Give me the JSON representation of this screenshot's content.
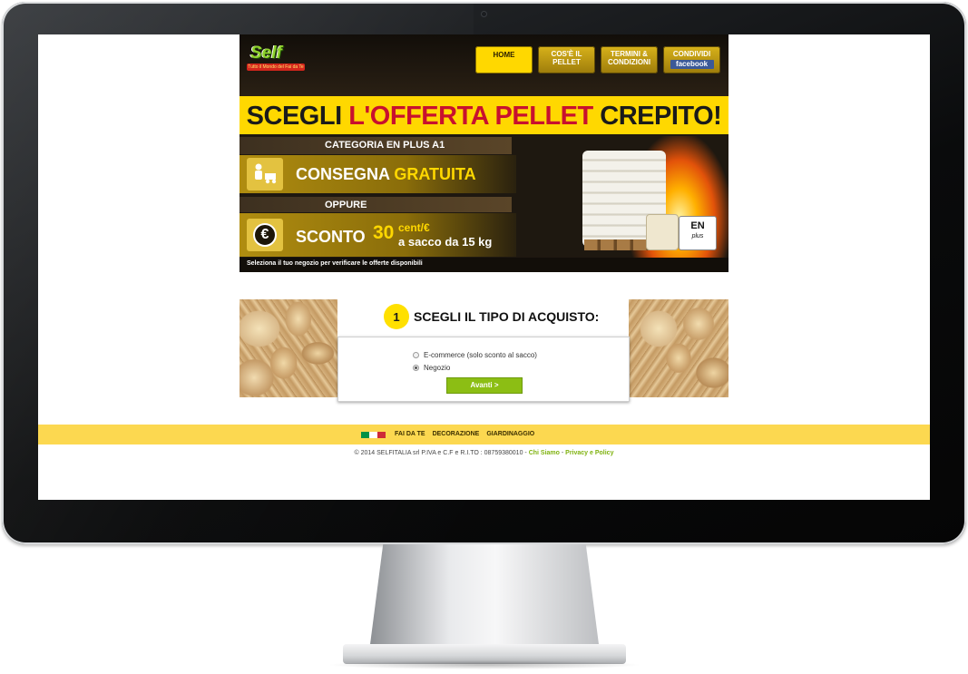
{
  "brand": {
    "logo_text": "Self",
    "tagline": "Tutto il Mondo del Fai da Te"
  },
  "nav": {
    "items": [
      {
        "label_1": "HOME",
        "label_2": "",
        "active": true
      },
      {
        "label_1": "COS'È IL",
        "label_2": "PELLET",
        "active": false
      },
      {
        "label_1": "TERMINI &",
        "label_2": "CONDIZIONI",
        "active": false
      },
      {
        "label_1": "CONDIVIDI",
        "label_2": "facebook",
        "active": false
      }
    ]
  },
  "banner": {
    "headline_a": "SCEGLI ",
    "headline_b": "L'OFFERTA PELLET",
    "headline_c": " CREPITO!",
    "category": "CATEGORIA EN PLUS A1",
    "consegna_a": "CONSEGNA ",
    "consegna_b": "GRATUITA",
    "oppure": "OPPURE",
    "sconto": "SCONTO",
    "sconto_value": "30",
    "sconto_unit": "cent/€",
    "sconto_detail": "a sacco da 15 kg",
    "euro_symbol": "€",
    "en_badge": "EN",
    "en_badge_sub": "plus",
    "note": "Seleziona il tuo negozio per verificare le offerte disponibili"
  },
  "step": {
    "number": "1",
    "title": "SCEGLI IL TIPO DI ACQUISTO:",
    "options": [
      {
        "label": "E-commerce (solo sconto al sacco)",
        "selected": false
      },
      {
        "label": "Negozio",
        "selected": true
      }
    ],
    "submit_label": "Avanti >"
  },
  "footer": {
    "links": [
      "FAI DA TE",
      "DECORAZIONE",
      "GIARDINAGGIO"
    ],
    "copyright": "© 2014 SELFITALIA srl P.IVA e C.F e R.I.TO : 08759380010 - ",
    "chi_siamo": "Chi Siamo",
    "separator": " - ",
    "privacy": "Privacy e Policy"
  },
  "colors": {
    "accent_yellow": "#ffd800",
    "accent_green": "#8cbe14",
    "headline_red": "#c8102e",
    "header_dark": "#1e1810"
  }
}
